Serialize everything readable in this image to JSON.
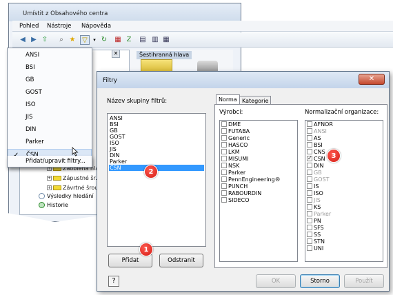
{
  "background_window": {
    "title": "Umístit z Obsahového centra",
    "menus": [
      "Pohled",
      "Nástroje",
      "Nápověda"
    ],
    "right_tab": "Šestihranná hlava",
    "tree_items": [
      "Zaoblená hla...",
      "Zápustné šr...",
      "Závrtné šrou..."
    ],
    "tree_extra": [
      "Výsledky hledání",
      "Historie"
    ]
  },
  "dropdown": {
    "items": [
      "ANSI",
      "BSI",
      "GB",
      "GOST",
      "ISO",
      "JIS",
      "DIN",
      "Parker",
      "ČSN"
    ],
    "selected": "ČSN",
    "action": "Přidat/upravit filtry..."
  },
  "dialog": {
    "title": "Filtry",
    "close_label": "✕",
    "group_label": "Název skupiny filtrů:",
    "groups": [
      "ANSI",
      "BSI",
      "GB",
      "GOST",
      "ISO",
      "JIS",
      "DIN",
      "Parker",
      "ČSN"
    ],
    "selected_group": "ČSN",
    "add_button": "Přidat",
    "remove_button": "Odstranit",
    "tabs": [
      "Norma",
      "Kategorie"
    ],
    "manufacturers_label": "Výrobci:",
    "manufacturers": [
      "DME",
      "FUTABA",
      "Generic",
      "HASCO",
      "LKM",
      "MISUMI",
      "NSK",
      "Parker",
      "PennEngineering®",
      "PUNCH",
      "RABOURDIN",
      "SIDECO"
    ],
    "standards_label": "Normalizační organizace:",
    "standards": [
      {
        "name": "AFNOR",
        "checked": false,
        "disabled": false
      },
      {
        "name": "ANSI",
        "checked": false,
        "disabled": true
      },
      {
        "name": "AS",
        "checked": false,
        "disabled": false
      },
      {
        "name": "BSI",
        "checked": false,
        "disabled": false
      },
      {
        "name": "CNS",
        "checked": false,
        "disabled": false
      },
      {
        "name": "CSN",
        "checked": true,
        "disabled": false
      },
      {
        "name": "DIN",
        "checked": false,
        "disabled": false
      },
      {
        "name": "GB",
        "checked": false,
        "disabled": true
      },
      {
        "name": "GOST",
        "checked": false,
        "disabled": true
      },
      {
        "name": "IS",
        "checked": false,
        "disabled": false
      },
      {
        "name": "ISO",
        "checked": false,
        "disabled": false
      },
      {
        "name": "JIS",
        "checked": false,
        "disabled": true
      },
      {
        "name": "KS",
        "checked": false,
        "disabled": false
      },
      {
        "name": "Parker",
        "checked": false,
        "disabled": true
      },
      {
        "name": "PN",
        "checked": false,
        "disabled": false
      },
      {
        "name": "SFS",
        "checked": false,
        "disabled": false
      },
      {
        "name": "SS",
        "checked": false,
        "disabled": false
      },
      {
        "name": "STN",
        "checked": false,
        "disabled": false
      },
      {
        "name": "UNI",
        "checked": false,
        "disabled": false
      }
    ],
    "ok_button": "OK",
    "cancel_button": "Storno",
    "apply_button": "Použít",
    "help_icon": "?"
  },
  "badges": [
    "1",
    "2",
    "3"
  ],
  "colors": {
    "selection": "#3399ff",
    "badge": "#d31d16"
  }
}
